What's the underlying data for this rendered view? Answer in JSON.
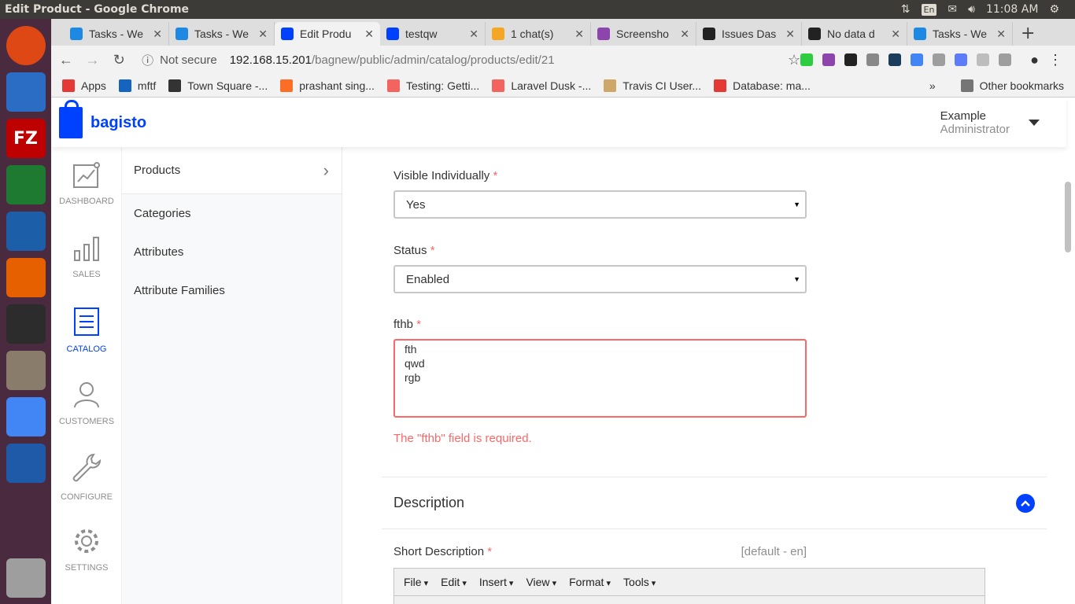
{
  "os": {
    "window_title": "Edit Product - Google Chrome",
    "keyboard": "En",
    "time": "11:08 AM",
    "launcher": [
      {
        "name": "ubuntu-dash-icon",
        "color": "#dd4814"
      },
      {
        "name": "thunderbird-icon",
        "color": "#2b6cc4"
      },
      {
        "name": "filezilla-icon",
        "color": "#bf0000",
        "text": "FZ"
      },
      {
        "name": "libreoffice-calc-icon",
        "color": "#1e7a30"
      },
      {
        "name": "libreoffice-writer-icon",
        "color": "#1c5ea8"
      },
      {
        "name": "firefox-icon",
        "color": "#e66000"
      },
      {
        "name": "terminal-icon",
        "color": "#2c2c2c"
      },
      {
        "name": "file-manager-icon",
        "color": "#8a7c6a"
      },
      {
        "name": "chrome-icon",
        "color": "#4285f4"
      },
      {
        "name": "vscode-icon",
        "color": "#1e5aa8"
      }
    ]
  },
  "browser": {
    "tabs": [
      {
        "label": "Tasks - We",
        "color": "#1e88e5"
      },
      {
        "label": "Tasks - We",
        "color": "#1e88e5"
      },
      {
        "label": "Edit Produ",
        "color": "#0041ff",
        "active": true
      },
      {
        "label": "testqw",
        "color": "#0041ff"
      },
      {
        "label": "1 chat(s)",
        "color": "#f5a623"
      },
      {
        "label": "Screensho",
        "color": "#8e44ad"
      },
      {
        "label": "Issues Das",
        "color": "#222222"
      },
      {
        "label": "No data d",
        "color": "#222222"
      },
      {
        "label": "Tasks - We",
        "color": "#1e88e5"
      }
    ],
    "address": {
      "not_secure": "Not secure",
      "host": "192.168.15.201",
      "path": "/bagnew/public/admin/catalog/products/edit/21"
    },
    "bookmarks": [
      {
        "label": "Apps",
        "color": "#e53935"
      },
      {
        "label": "mftf",
        "color": "#1565c0"
      },
      {
        "label": "Town Square -...",
        "color": "#333333"
      },
      {
        "label": "prashant sing...",
        "color": "#fc6d26"
      },
      {
        "label": "Testing: Getti...",
        "color": "#f4645f"
      },
      {
        "label": "Laravel Dusk -...",
        "color": "#f4645f"
      },
      {
        "label": "Travis CI User...",
        "color": "#cda869"
      },
      {
        "label": "Database: ma...",
        "color": "#e53935"
      }
    ],
    "other_bookmarks": "Other bookmarks",
    "more": "»"
  },
  "app": {
    "brand": "bagisto",
    "user": {
      "name": "Example",
      "role": "Administrator"
    },
    "nav": [
      {
        "label": "DASHBOARD",
        "icon": "dashboard-icon"
      },
      {
        "label": "SALES",
        "icon": "sales-icon"
      },
      {
        "label": "CATALOG",
        "icon": "catalog-icon",
        "active": true
      },
      {
        "label": "CUSTOMERS",
        "icon": "customers-icon"
      },
      {
        "label": "CONFIGURE",
        "icon": "configure-icon"
      },
      {
        "label": "SETTINGS",
        "icon": "settings-icon"
      }
    ],
    "submenu": [
      "Products",
      "Categories",
      "Attributes",
      "Attribute Families"
    ],
    "form": {
      "visible_individually": {
        "label": "Visible Individually",
        "value": "Yes"
      },
      "status": {
        "label": "Status",
        "value": "Enabled"
      },
      "fthb": {
        "label": "fthb",
        "lines": [
          "fth",
          "qwd",
          "rgb"
        ],
        "error": "The \"fthb\" field is required."
      },
      "required_mark": "*"
    },
    "description_section": {
      "title": "Description"
    },
    "short_description": {
      "label": "Short Description",
      "locale": "[default - en]"
    },
    "editor_menu": [
      "File",
      "Edit",
      "Insert",
      "View",
      "Format",
      "Tools"
    ]
  }
}
